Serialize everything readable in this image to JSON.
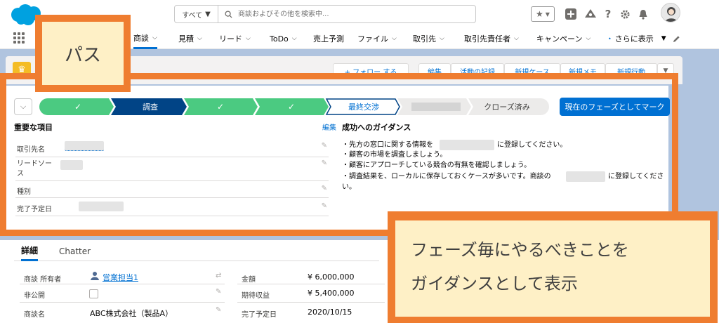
{
  "search": {
    "scope": "すべて",
    "placeholder": "商談およびその他を検索中..."
  },
  "nav": {
    "items": [
      {
        "label": "商談",
        "active": true
      },
      {
        "label": "見積"
      },
      {
        "label": "リード"
      },
      {
        "label": "ToDo"
      },
      {
        "label": "売上予測"
      },
      {
        "label": "ファイル"
      },
      {
        "label": "取引先"
      },
      {
        "label": "取引先責任者"
      },
      {
        "label": "キャンペーン"
      },
      {
        "label": "さらに表示"
      }
    ]
  },
  "record_header": {
    "buttons": [
      "+ フォロー する",
      "編集",
      "活動の記録",
      "新規ケース",
      "新規メモ",
      "新規行動"
    ]
  },
  "path": {
    "stages": [
      {
        "label": "",
        "status": "complete"
      },
      {
        "label": "調査",
        "status": "current"
      },
      {
        "label": "",
        "status": "complete"
      },
      {
        "label": "",
        "status": "complete"
      },
      {
        "label": "最終交渉",
        "status": "selected"
      },
      {
        "label": "",
        "status": "hidden"
      },
      {
        "label": "クローズ済み",
        "status": "incomplete"
      }
    ],
    "mark_button": "現在のフェーズとしてマーク",
    "colors": {
      "complete": "#4bca81",
      "current": "#014486",
      "selected_text": "#0070d2",
      "incomplete": "#ecebea"
    }
  },
  "key_fields": {
    "title": "重要な項目",
    "edit": "編集",
    "fields": [
      "取引先名",
      "リードソース",
      "種別",
      "完了予定日"
    ]
  },
  "guidance": {
    "title": "成功へのガイダンス",
    "lines": [
      "・先方の窓口に関する情報を",
      "に登録してください。",
      "・顧客の市場を調査しましょう。",
      "・顧客にアプローチしている競合の有無を確認しましょう。",
      "・調査結果を、ローカルに保存しておくケースが多いです。商談の",
      "に登録してくださ",
      "い。"
    ]
  },
  "callouts": {
    "path": "パス",
    "guidance_line1": "フェーズ毎にやるべきことを",
    "guidance_line2": "ガイダンスとして表示"
  },
  "tabs": {
    "details": "詳細",
    "chatter": "Chatter"
  },
  "details": {
    "owner_label": "商談 所有者",
    "owner_value": "営業担当1",
    "private_label": "非公開",
    "name_label": "商談名",
    "name_value": "ABC株式会社（製品A）",
    "amount_label": "金額",
    "amount_value": "¥ 6,000,000",
    "expected_label": "期待収益",
    "expected_value": "¥ 5,400,000",
    "close_label": "完了予定日",
    "close_value": "2020/10/15"
  }
}
